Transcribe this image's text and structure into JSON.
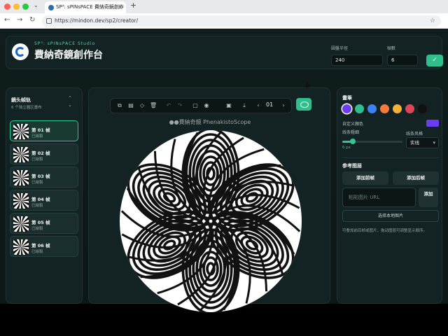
{
  "browser": {
    "tab_title": "SP³: sPINsPACE 費納奇鏡創作",
    "url": "https://mindon.dev/sp2/creator/"
  },
  "header": {
    "subtitle": "SP³: sPINsPACE Studio",
    "title": "費納奇鏡創作台",
    "radius_label": "圓盤半徑",
    "radius_value": "240",
    "frames_label": "幀數",
    "frames_value": "6",
    "confirm_icon": "check-icon"
  },
  "left_panel": {
    "title": "鏡头幀轨",
    "hint": "6 个独立圓区畫布",
    "frames": [
      {
        "name": "第 01 帧",
        "status": "已繪製",
        "active": true
      },
      {
        "name": "第 02 帧",
        "status": "已繪製",
        "active": false
      },
      {
        "name": "第 03 帧",
        "status": "已繪製",
        "active": false
      },
      {
        "name": "第 04 帧",
        "status": "已繪製",
        "active": false
      },
      {
        "name": "第 05 帧",
        "status": "已繪製",
        "active": false
      },
      {
        "name": "第 06 帧",
        "status": "已繪製",
        "active": false
      }
    ]
  },
  "toolbar": {
    "page": "01",
    "icons": [
      "copy-icon",
      "paste-icon",
      "eraser-icon",
      "trash-icon",
      "undo-icon",
      "redo-icon",
      "frame-icon",
      "camera-icon",
      "image-icon",
      "download-icon",
      "prev-icon",
      "next-icon",
      "eye-icon"
    ]
  },
  "canvas": {
    "title": "●●費納奇鏡 PhenakistoScope"
  },
  "right_panel": {
    "brush_title": "畫筆",
    "swatches": [
      "#6b3cf0",
      "#2fbe8c",
      "#3b82f6",
      "#f47b3c",
      "#f3b13a",
      "#e0445a",
      "#111111"
    ],
    "custom_color_label": "自定义顏色",
    "custom_color": "#6b3cf0",
    "line_width_label": "线条粗细",
    "line_width_value": "6 px",
    "line_width_fraction": 0.18,
    "line_style_label": "线条风格",
    "line_style_value": "实线",
    "ref_title": "参考图层",
    "add_before": "添加前帧",
    "add_after": "添加后帧",
    "url_placeholder": "粘貼图片 URL",
    "add_label": "添加",
    "local_image": "选择本地图片",
    "note": "可叠加前后帧或图片，拖动图层可调整显示顺序。"
  }
}
